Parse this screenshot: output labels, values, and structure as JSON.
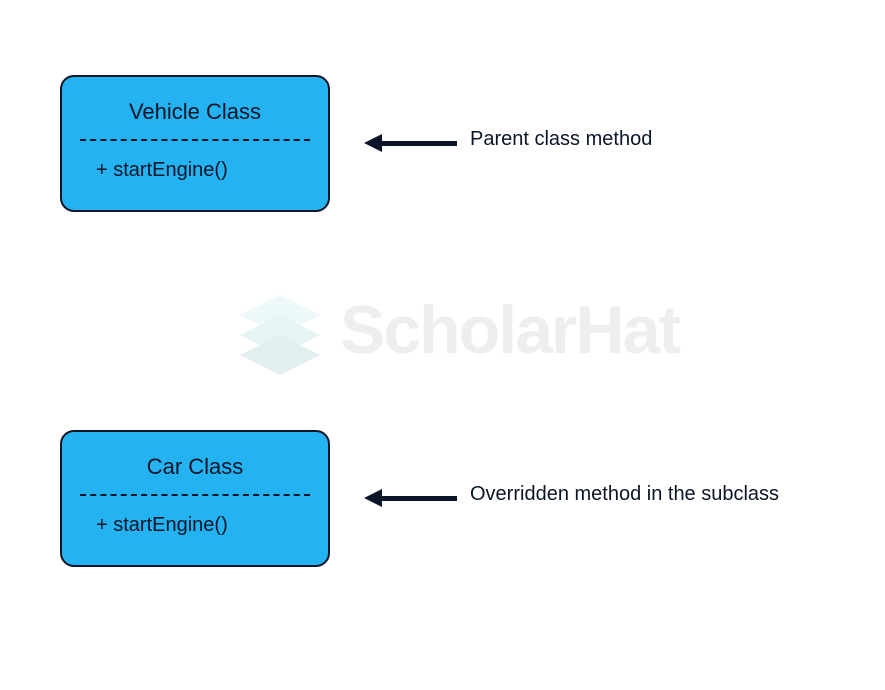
{
  "watermark": {
    "text": "ScholarHat"
  },
  "class1": {
    "title": "Vehicle Class",
    "method": "+  startEngine()"
  },
  "class2": {
    "title": "Car Class",
    "method": "+  startEngine()"
  },
  "label1": "Parent class method",
  "label2": "Overridden method in the subclass"
}
